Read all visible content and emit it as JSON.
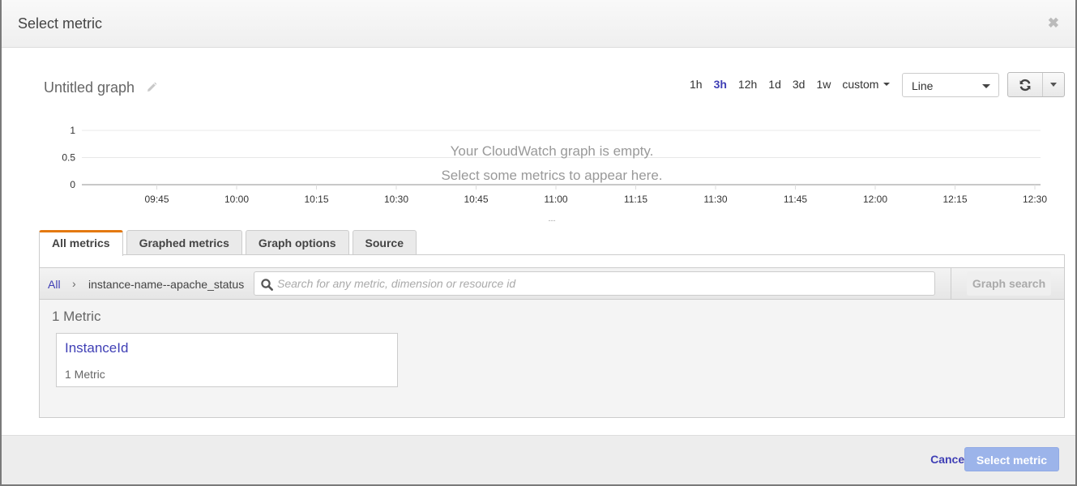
{
  "modal": {
    "title": "Select metric",
    "close_icon": "close-icon"
  },
  "graph": {
    "title": "Untitled graph",
    "edit_icon": "pencil-icon",
    "time_ranges": [
      {
        "label": "1h",
        "active": false
      },
      {
        "label": "3h",
        "active": true
      },
      {
        "label": "12h",
        "active": false
      },
      {
        "label": "1d",
        "active": false
      },
      {
        "label": "3d",
        "active": false
      },
      {
        "label": "1w",
        "active": false
      }
    ],
    "custom_label": "custom",
    "chart_type": "Line",
    "refresh_icon": "refresh-icon",
    "empty_line1": "Your CloudWatch graph is empty.",
    "empty_line2": "Select some metrics to appear here.",
    "legend_placeholder": "---"
  },
  "chart_data": {
    "type": "line",
    "title": "",
    "xlabel": "",
    "ylabel": "",
    "series": [],
    "x_ticks": [
      "09:45",
      "10:00",
      "10:15",
      "10:30",
      "10:45",
      "11:00",
      "11:15",
      "11:30",
      "11:45",
      "12:00",
      "12:15",
      "12:30"
    ],
    "y_ticks": [
      "1",
      "0.5",
      "0"
    ],
    "ylim": [
      0,
      1
    ],
    "grid": true
  },
  "tabs": [
    {
      "label": "All metrics",
      "active": true
    },
    {
      "label": "Graphed metrics",
      "active": false
    },
    {
      "label": "Graph options",
      "active": false
    },
    {
      "label": "Source",
      "active": false
    }
  ],
  "browser": {
    "breadcrumb_root": "All",
    "breadcrumb_separator": "›",
    "breadcrumb_namespace": "instance-name--apache_status",
    "search_placeholder": "Search for any metric, dimension or resource id",
    "search_value": "",
    "graph_search_label": "Graph search",
    "metric_count": "1 Metric",
    "cards": [
      {
        "name": "InstanceId",
        "count": "1 Metric"
      }
    ]
  },
  "footer": {
    "cancel_label": "Cancel",
    "select_label": "Select metric"
  },
  "colors": {
    "accent_link": "#3f3fb5",
    "active_tab_border": "#e47911",
    "primary_button": "#9cb4ea"
  }
}
